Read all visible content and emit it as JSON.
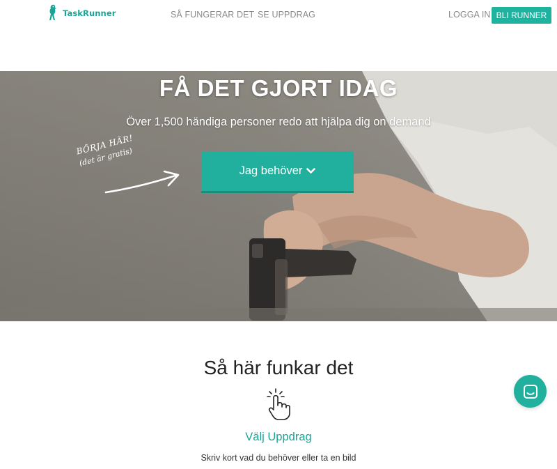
{
  "header": {
    "logo_text": "TaskRunner",
    "nav": {
      "how_it_works": "SÅ FUNGERAR DET",
      "see_jobs": "SE UPPDRAG",
      "login": "LOGGA IN",
      "become_runner": "BLI RUNNER"
    }
  },
  "hero": {
    "title": "FÅ DET GJORT IDAG",
    "subtitle": "Över 1,500 händiga personer redo att hjälpa dig on demand",
    "start_hint": {
      "line1": "BÖRJA HÄR!",
      "line2": "(det är gratis)"
    },
    "need_button": "Jag behöver"
  },
  "how": {
    "title": "Så här funkar det",
    "step_title": "Välj Uppdrag",
    "step_desc": "Skriv kort vad du behöver eller ta en bild"
  },
  "icons": {
    "logo": "taskrunner-bird-logo",
    "chevron": "chevron-down-icon",
    "hand": "hand-pointer-icon",
    "chat": "chat-icon"
  },
  "colors": {
    "accent": "#1fb39f",
    "accent_dark": "#15907f",
    "nav_text": "#8a8a8a",
    "hero_text": "#ffffff"
  }
}
